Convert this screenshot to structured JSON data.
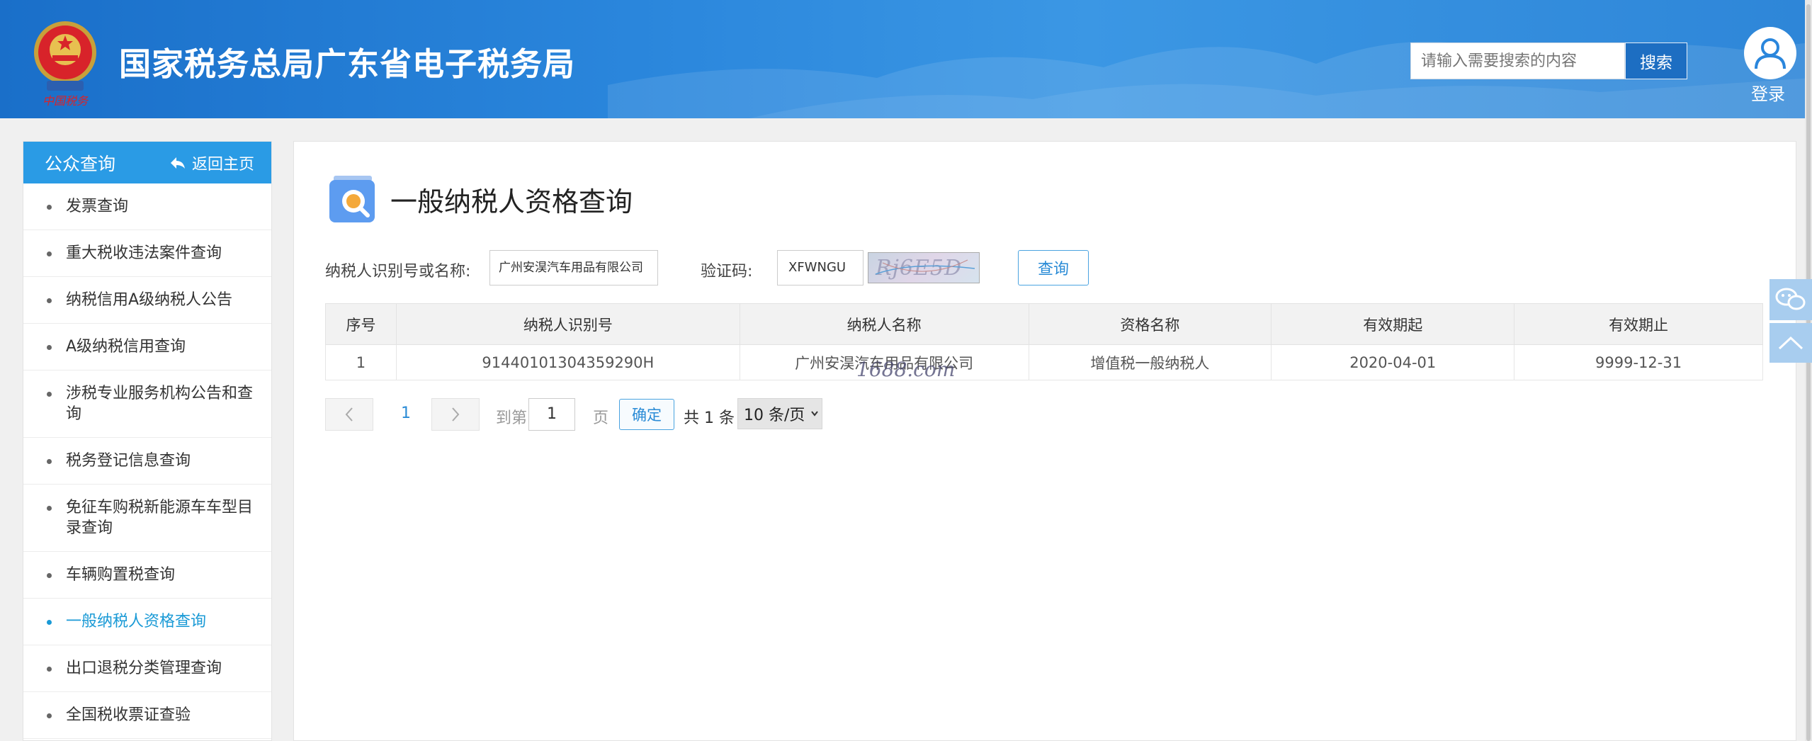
{
  "header": {
    "site_title": "国家税务总局广东省电子税务局",
    "logo_caption": "中国税务",
    "search_placeholder": "请输入需要搜索的内容",
    "search_button": "搜索",
    "login_label": "登录"
  },
  "sidebar": {
    "title": "公众查询",
    "back_label": "返回主页",
    "items": [
      {
        "label": "发票查询",
        "active": false
      },
      {
        "label": "重大税收违法案件查询",
        "active": false
      },
      {
        "label": "纳税信用A级纳税人公告",
        "active": false
      },
      {
        "label": "A级纳税信用查询",
        "active": false
      },
      {
        "label": "涉税专业服务机构公告和查询",
        "active": false
      },
      {
        "label": "税务登记信息查询",
        "active": false
      },
      {
        "label": "免征车购税新能源车车型目录查询",
        "active": false
      },
      {
        "label": "车辆购置税查询",
        "active": false
      },
      {
        "label": "一般纳税人资格查询",
        "active": true
      },
      {
        "label": "出口退税分类管理查询",
        "active": false
      },
      {
        "label": "全国税收票证查验",
        "active": false
      }
    ]
  },
  "main": {
    "page_title": "一般纳税人资格查询",
    "form": {
      "taxpayer_label": "纳税人识别号或名称:",
      "taxpayer_value": "广州安淏汽车用品有限公司",
      "captcha_label": "验证码:",
      "captcha_value": "XFWNGU",
      "captcha_image_text": "Rj6E5D",
      "query_button": "查询"
    },
    "table": {
      "columns": [
        "序号",
        "纳税人识别号",
        "纳税人名称",
        "资格名称",
        "有效期起",
        "有效期止"
      ],
      "rows": [
        [
          "1",
          "91440101304359290H",
          "广州安淏汽车用品有限公司",
          "增值税一般纳税人",
          "2020-04-01",
          "9999-12-31"
        ]
      ]
    },
    "watermark": "1688.com",
    "pagination": {
      "current_page": "1",
      "goto_label": "到第",
      "goto_value": "1",
      "page_label": "页",
      "confirm_button": "确定",
      "total_label": "共 1 条",
      "page_size": "10 条/页"
    }
  },
  "colors": {
    "header_blue": "#2a86dc",
    "sidebar_head": "#2a9be5",
    "active_link": "#1a9ad6",
    "accent_button": "#1d6ec2"
  }
}
